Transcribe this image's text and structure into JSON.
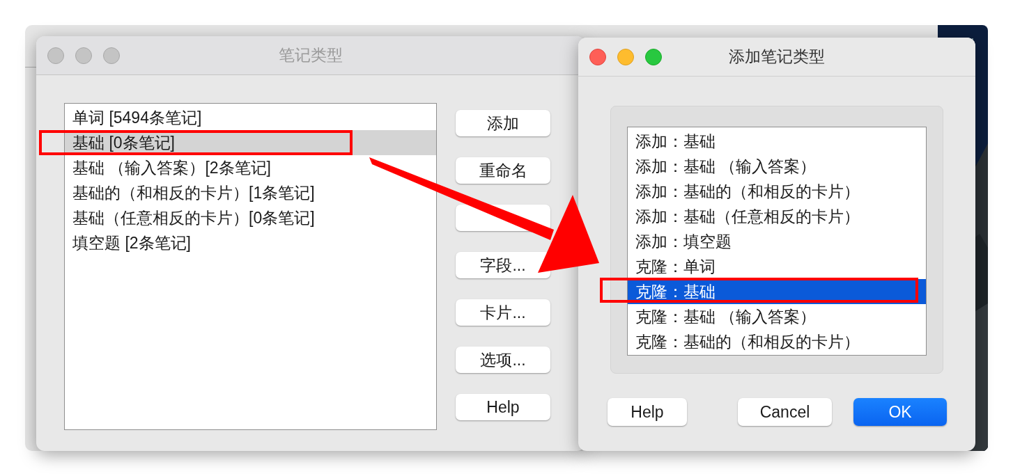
{
  "note_types_window": {
    "title": "笔记类型",
    "active": false,
    "items": [
      {
        "label": "单词 [5494条笔记]",
        "selected": false
      },
      {
        "label": "基础 [0条笔记]",
        "selected": true
      },
      {
        "label": "基础 （输入答案）[2条笔记]",
        "selected": false
      },
      {
        "label": "基础的（和相反的卡片）[1条笔记]",
        "selected": false
      },
      {
        "label": "基础（任意相反的卡片）[0条笔记]",
        "selected": false
      },
      {
        "label": "填空题 [2条笔记]",
        "selected": false
      }
    ],
    "buttons": [
      {
        "kind": "labeled",
        "label": "添加"
      },
      {
        "kind": "labeled",
        "label": "重命名"
      },
      {
        "kind": "covered"
      },
      {
        "kind": "labeled",
        "label": "字段..."
      },
      {
        "kind": "labeled",
        "label": "卡片..."
      },
      {
        "kind": "labeled",
        "label": "选项..."
      },
      {
        "kind": "labeled",
        "label": "Help"
      }
    ]
  },
  "add_note_type_dialog": {
    "title": "添加笔记类型",
    "active": true,
    "items": [
      {
        "label": "添加：基础",
        "selected": false
      },
      {
        "label": "添加：基础 （输入答案）",
        "selected": false
      },
      {
        "label": "添加：基础的（和相反的卡片）",
        "selected": false
      },
      {
        "label": "添加：基础（任意相反的卡片）",
        "selected": false
      },
      {
        "label": "添加：填空题",
        "selected": false
      },
      {
        "label": "克隆：单词",
        "selected": false
      },
      {
        "label": "克隆：基础",
        "selected": true
      },
      {
        "label": "克隆：基础 （输入答案）",
        "selected": false
      },
      {
        "label": "克隆：基础的（和相反的卡片）",
        "selected": false
      }
    ],
    "buttons": [
      {
        "label": "Help",
        "kind": "plain"
      },
      {
        "label": "Cancel",
        "kind": "plain"
      },
      {
        "label": "OK",
        "kind": "default"
      }
    ]
  }
}
